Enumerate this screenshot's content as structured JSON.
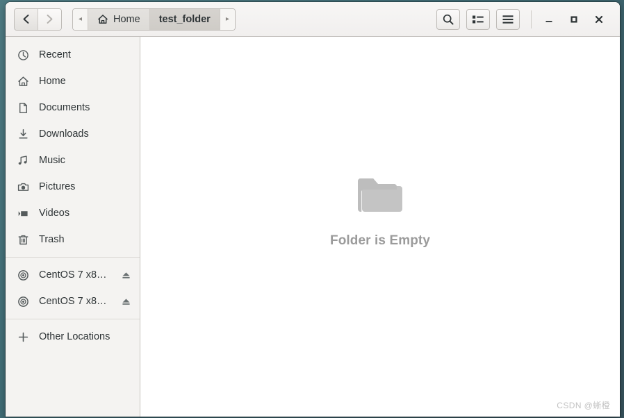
{
  "window": {
    "title": "test_folder",
    "controls": {
      "minimize": "–",
      "maximize": "□",
      "close": "✕"
    }
  },
  "headerbar": {
    "nav": {
      "back_label": "Back",
      "forward_label": "Forward"
    },
    "breadcrumb": {
      "prev_arrow": "◂",
      "next_arrow": "▸",
      "items": [
        {
          "label": "Home",
          "icon": "home-icon",
          "current": false
        },
        {
          "label": "test_folder",
          "icon": "",
          "current": true
        }
      ]
    },
    "actions": [
      {
        "name": "search-button",
        "icon": "search-icon"
      },
      {
        "name": "view-options-button",
        "icon": "list-view-icon"
      },
      {
        "name": "menu-button",
        "icon": "hamburger-menu-icon"
      }
    ]
  },
  "sidebar": {
    "places": [
      {
        "label": "Recent",
        "icon": "clock-icon"
      },
      {
        "label": "Home",
        "icon": "home-icon"
      },
      {
        "label": "Documents",
        "icon": "document-icon"
      },
      {
        "label": "Downloads",
        "icon": "download-icon"
      },
      {
        "label": "Music",
        "icon": "music-note-icon"
      },
      {
        "label": "Pictures",
        "icon": "camera-icon"
      },
      {
        "label": "Videos",
        "icon": "video-icon"
      },
      {
        "label": "Trash",
        "icon": "trash-icon"
      }
    ],
    "devices": [
      {
        "label": "CentOS 7 x8…",
        "icon": "optical-disc-icon",
        "eject": "eject-icon"
      },
      {
        "label": "CentOS 7 x8…",
        "icon": "optical-disc-icon",
        "eject": "eject-icon"
      }
    ],
    "other": {
      "label": "Other Locations",
      "icon": "plus-icon"
    }
  },
  "content": {
    "empty_state": {
      "icon": "folder-icon",
      "message": "Folder is Empty"
    },
    "watermark": "CSDN @蜥橙"
  },
  "colors": {
    "desktop": "#4e7a82",
    "header_bg": "#f3f1f0",
    "sidebar_bg": "#f4f3f1",
    "content_bg": "#ffffff",
    "text": "#2e3436",
    "muted_text": "#9b9b9b",
    "icon": "#555b5c"
  }
}
